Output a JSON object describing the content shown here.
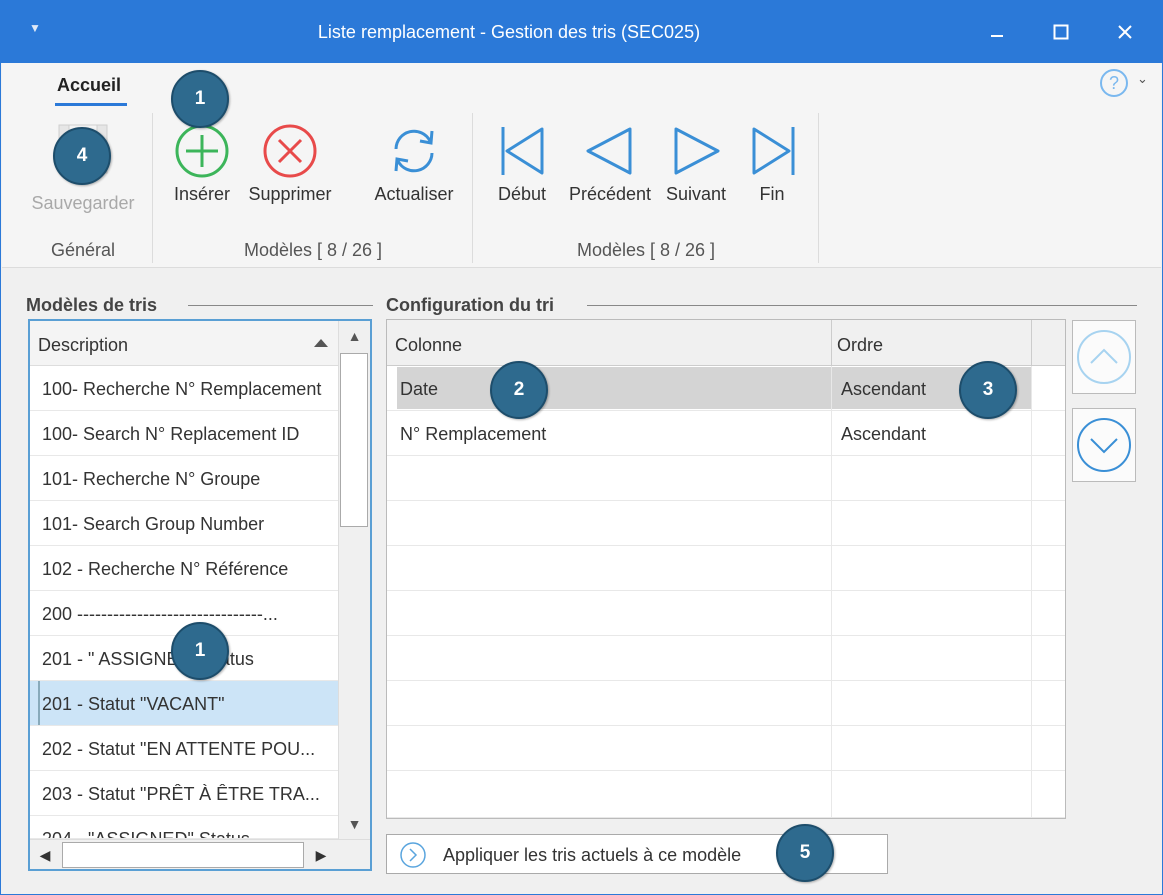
{
  "window": {
    "title": "Liste remplacement - Gestion des tris (SEC025)"
  },
  "ribbon": {
    "tab_label": "Accueil",
    "help_label": "?",
    "buttons": {
      "save": "Sauvegarder",
      "insert": "Insérer",
      "delete": "Supprimer",
      "refresh": "Actualiser",
      "first": "Début",
      "previous": "Précédent",
      "next": "Suivant",
      "last": "Fin"
    },
    "groups": {
      "general": "Général",
      "models1": "Modèles [ 8 / 26 ]",
      "models2": "Modèles [ 8 / 26 ]"
    }
  },
  "left_panel": {
    "title": "Modèles de tris",
    "column_header": "Description",
    "rows": [
      "100- Recherche N° Remplacement",
      "100- Search N° Replacement ID",
      "101- Recherche N° Groupe",
      "101- Search Group Number",
      "102 - Recherche N° Référence",
      "200 -------------------------------...",
      "201 - \" ASSIGNED\" Status",
      "201 - Statut \"VACANT\"",
      "202 - Statut \"EN ATTENTE POU...",
      "203 - Statut \"PRÊT À ÊTRE TRA...",
      "204 - \"ASSIGNED\" Status"
    ],
    "selected_index": 7
  },
  "right_panel": {
    "title": "Configuration du tri",
    "columns": [
      "Colonne",
      "Ordre"
    ],
    "rows": [
      {
        "colonne": "Date",
        "ordre": "Ascendant"
      },
      {
        "colonne": "N° Remplacement",
        "ordre": "Ascendant"
      }
    ],
    "apply_label": "Appliquer les tris actuels à ce modèle"
  },
  "badges": [
    "1",
    "4",
    "2",
    "3",
    "1",
    "5"
  ],
  "colors": {
    "accent": "#2b79d8",
    "badge": "#2e6a8e",
    "insert_green": "#3cb55a",
    "delete_red": "#e84a4a",
    "nav_blue": "#3a8fd6"
  }
}
